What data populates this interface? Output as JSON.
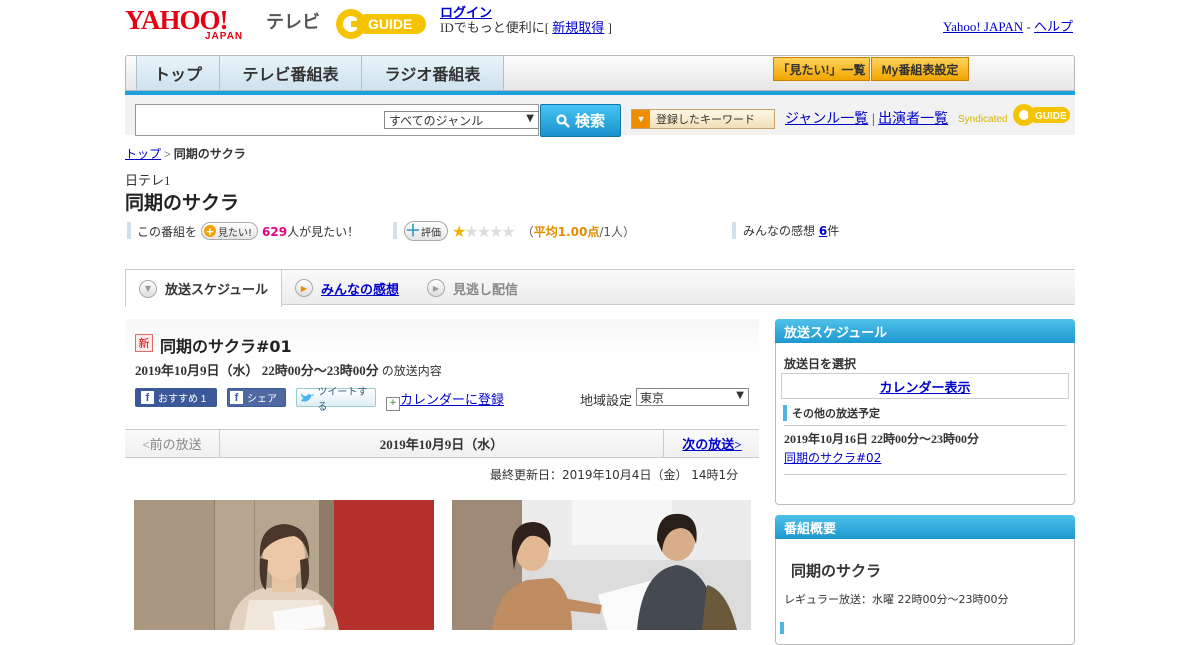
{
  "header": {
    "logo_text": "YAHOO!",
    "logo_sub": "JAPAN",
    "service": "テレビ",
    "gguide_text": "GUIDE",
    "login_label": "ログイン",
    "login_note_prefix": "IDでもっと便利に[ ",
    "signup_label": "新規取得",
    "login_note_suffix": " ]",
    "yj_link": "Yahoo! JAPAN",
    "sep": " - ",
    "help_link": "ヘルプ"
  },
  "nav": {
    "tabs": [
      "トップ",
      "テレビ番組表",
      "ラジオ番組表"
    ],
    "want_list": "「見たい!」一覧",
    "my_schedule": "My番組表設定"
  },
  "search": {
    "placeholder": "",
    "genre": "すべてのジャンル",
    "button": "検索",
    "keyword_button": "登録したキーワード",
    "genre_list": "ジャンル一覧",
    "divider": "|",
    "performer_list": "出演者一覧",
    "syndicated": "Syndicated"
  },
  "breadcrumb": {
    "top": "トップ",
    "sep": " > ",
    "current": "同期のサクラ"
  },
  "program": {
    "channel": "日テレ1",
    "title": "同期のサクラ",
    "want_prefix": "この番組を",
    "want_button": "見たい!",
    "want_count": "629",
    "want_suffix": "人が見たい！",
    "rate_button": "評価",
    "rating_stars": 1,
    "rating_open": "（",
    "rating_avg": "平均1.00点",
    "rating_count": "/1人）",
    "review_prefix": "みんなの感想 ",
    "review_count": "6",
    "review_suffix": "件"
  },
  "content_tabs": {
    "schedule": "放送スケジュール",
    "reviews": "みんなの感想",
    "streaming": "見逃し配信"
  },
  "episode": {
    "badge": "新",
    "title": "同期のサクラ#01",
    "time": "2019年10月9日（水） 22時00分～23時00分",
    "time_suffix": " の放送内容",
    "fb_recommend": "おすすめ 1",
    "fb_share": "シェア",
    "tweet": "ツイートする",
    "calendar": "カレンダーに登録",
    "region_label": "地域設定",
    "region_value": "東京",
    "prev": "<前の放送",
    "current_date": "2019年10月9日（水）",
    "next": "次の放送>",
    "updated": "最終更新日：2019年10月4日（金） 14時1分"
  },
  "sidebar": {
    "schedule_head": "放送スケジュール",
    "select_date": "放送日を選択",
    "calendar_view": "カレンダー表示",
    "other_label": "その他の放送予定",
    "other_date": "2019年10月16日 22時00分～23時00分",
    "other_ep": "同期のサクラ#02",
    "overview_head": "番組概要",
    "overview_title": "同期のサクラ",
    "regular": "レギュラー放送：水曜 22時00分～23時00分"
  },
  "colors": {
    "accent_blue": "#1ea2dd",
    "yahoo_red": "#e60012",
    "orange": "#f0a400",
    "pink": "#e4007f"
  }
}
